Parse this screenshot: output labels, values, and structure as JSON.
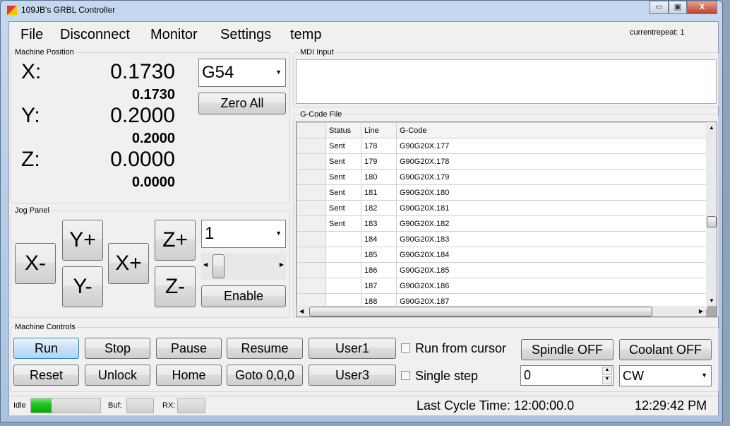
{
  "window": {
    "title": "109JB's GRBL Controller",
    "minimize": "▭",
    "maximize": "▣",
    "close": "X"
  },
  "menu": [
    "File",
    "Disconnect",
    "Monitor",
    "Settings",
    "temp"
  ],
  "current_repeat": "currentrepeat: 1",
  "machine_position": {
    "label": "Machine Position",
    "axes": [
      {
        "name": "X:",
        "value": "0.1730",
        "sub": "0.1730"
      },
      {
        "name": "Y:",
        "value": "0.2000",
        "sub": "0.2000"
      },
      {
        "name": "Z:",
        "value": "0.0000",
        "sub": "0.0000"
      }
    ],
    "coord_system": "G54",
    "zero_all": "Zero All"
  },
  "jog_panel": {
    "label": "Jog Panel",
    "buttons": {
      "xminus": "X-",
      "yplus": "Y+",
      "yminus": "Y-",
      "xplus": "X+",
      "zplus": "Z+",
      "zminus": "Z-"
    },
    "step": "1",
    "enable": "Enable"
  },
  "mdi": {
    "label": "MDI Input",
    "value": ""
  },
  "gcode": {
    "label": "G-Code File",
    "columns": [
      "Status",
      "Line",
      "G-Code"
    ],
    "rows": [
      [
        "Sent",
        "178",
        "G90G20X.177"
      ],
      [
        "Sent",
        "179",
        "G90G20X.178"
      ],
      [
        "Sent",
        "180",
        "G90G20X.179"
      ],
      [
        "Sent",
        "181",
        "G90G20X.180"
      ],
      [
        "Sent",
        "182",
        "G90G20X.181"
      ],
      [
        "Sent",
        "183",
        "G90G20X.182"
      ],
      [
        "",
        "184",
        "G90G20X.183"
      ],
      [
        "",
        "185",
        "G90G20X.184"
      ],
      [
        "",
        "186",
        "G90G20X.185"
      ],
      [
        "",
        "187",
        "G90G20X.186"
      ],
      [
        "",
        "188",
        "G90G20X.187"
      ]
    ]
  },
  "controls": {
    "label": "Machine Controls",
    "run": "Run",
    "stop": "Stop",
    "pause": "Pause",
    "resume": "Resume",
    "user1": "User1",
    "reset": "Reset",
    "unlock": "Unlock",
    "home": "Home",
    "goto": "Goto 0,0,0",
    "user3": "User3",
    "run_from_cursor": "Run from cursor",
    "single_step": "Single step",
    "spindle": "Spindle OFF",
    "coolant": "Coolant OFF",
    "spindle_speed": "0",
    "direction": "CW",
    "accent": "#c9e0f7"
  },
  "status": {
    "state": "Idle",
    "state_progress": 0.3,
    "buf": "Buf:",
    "rx": "RX:",
    "last_cycle": "Last Cycle Time: 12:00:00.0",
    "clock": "12:29:42 PM"
  }
}
